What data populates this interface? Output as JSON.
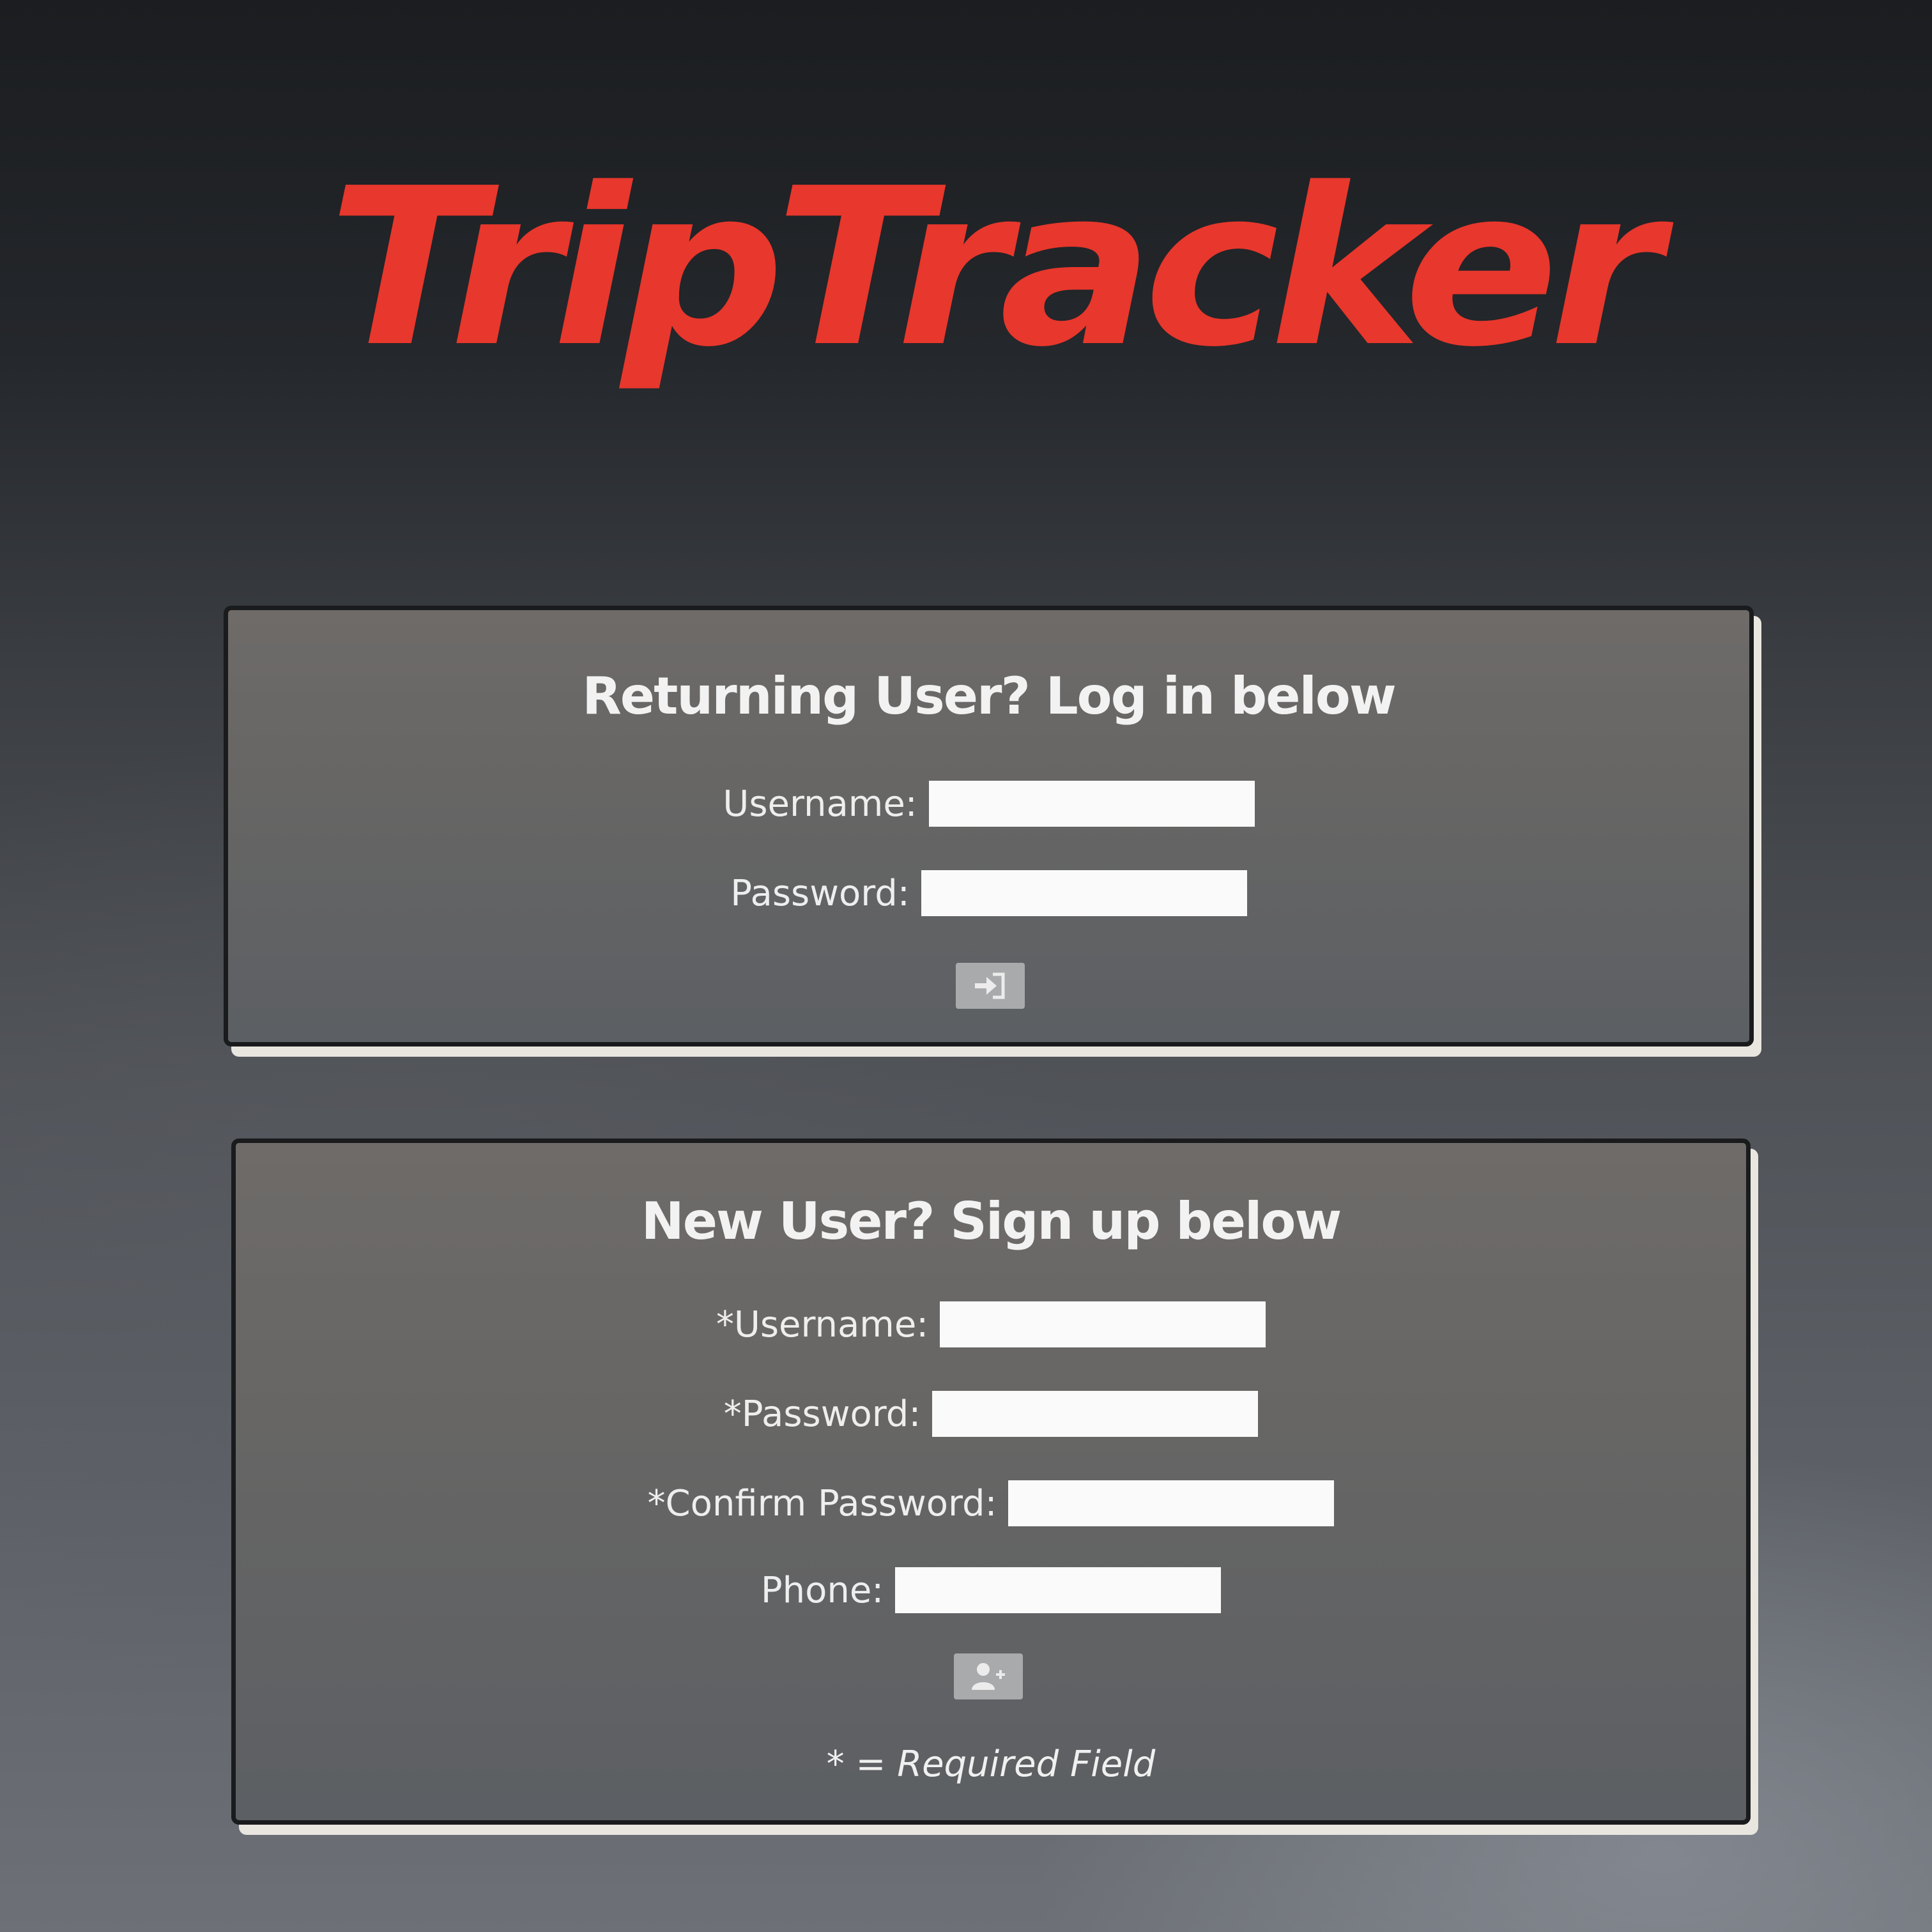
{
  "app": {
    "logo_text": "TripTracker",
    "logo_color": "#e8372c"
  },
  "login": {
    "title": "Returning User? Log in below",
    "username_label": "Username:",
    "username_value": "",
    "password_label": "Password:",
    "password_value": "",
    "submit_icon": "sign-in-icon"
  },
  "signup": {
    "title": "New User? Sign up below",
    "username_label": "*Username:",
    "username_value": "",
    "password_label": "*Password:",
    "password_value": "",
    "confirm_label": "*Confirm Password:",
    "confirm_value": "",
    "phone_label": "Phone:",
    "phone_value": "",
    "submit_icon": "add-user-icon",
    "required_note": "* = Required Field"
  }
}
